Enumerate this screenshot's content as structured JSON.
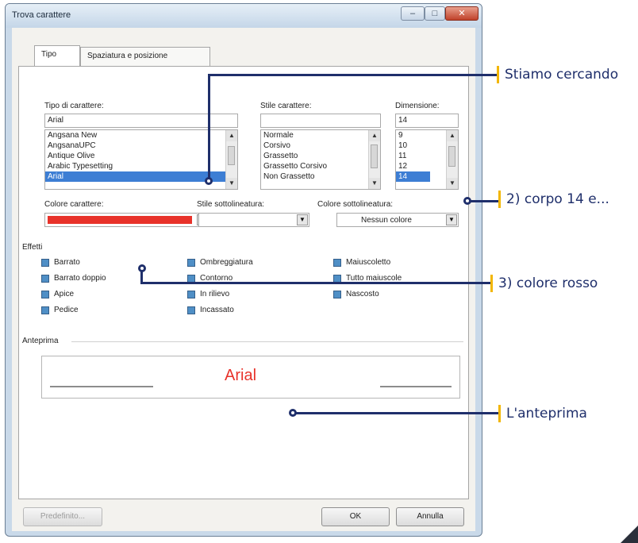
{
  "window": {
    "title": "Trova carattere",
    "buttons": [
      "–",
      "□",
      "✕"
    ]
  },
  "tabs": [
    {
      "label": "Tipo",
      "active": true
    },
    {
      "label": "Spaziatura e posizione",
      "active": false
    }
  ],
  "font": {
    "label": "Tipo di carattere:",
    "value": "Arial",
    "items": [
      "Angsana New",
      "AngsanaUPC",
      "Antique Olive",
      "Arabic Typesetting",
      "Arial"
    ],
    "selected": "Arial"
  },
  "style": {
    "label": "Stile carattere:",
    "value": "",
    "items": [
      "Normale",
      "Corsivo",
      "Grassetto",
      "Grassetto Corsivo",
      "Non Grassetto"
    ]
  },
  "size": {
    "label": "Dimensione:",
    "value": "14",
    "items": [
      "9",
      "10",
      "11",
      "12",
      "14"
    ],
    "selected": "14"
  },
  "color": {
    "label": "Colore carattere:",
    "value_color": "#e8322a"
  },
  "underline": {
    "label": "Stile sottolineatura:",
    "value": ""
  },
  "underline_color": {
    "label": "Colore sottolineatura:",
    "value": "Nessun colore"
  },
  "effects": {
    "label": "Effetti",
    "col1": [
      "Barrato",
      "Barrato doppio",
      "Apice",
      "Pedice"
    ],
    "col2": [
      "Ombreggiatura",
      "Contorno",
      "In rilievo",
      "Incassato"
    ],
    "col3": [
      "Maiuscoletto",
      "Tutto maiuscole",
      "Nascosto"
    ]
  },
  "preview": {
    "label": "Anteprima",
    "text": "Arial",
    "text_color": "#e8322a"
  },
  "footer": {
    "default_label": "Predefinito...",
    "ok_label": "OK",
    "cancel_label": "Annulla"
  },
  "annotations": [
    {
      "text": "Stiamo cercando"
    },
    {
      "text": "2) corpo 14 e..."
    },
    {
      "text": "3) colore rosso"
    },
    {
      "text": "L'anteprima"
    }
  ],
  "accent": "#1f2f6b",
  "marker": "#f2b600"
}
